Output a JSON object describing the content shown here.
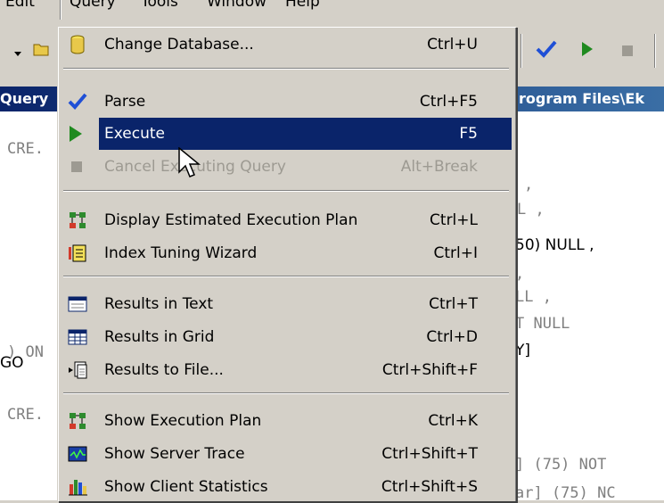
{
  "menubar": {
    "items": [
      "Edit",
      "Query",
      "Tools",
      "Window",
      "Help"
    ]
  },
  "window": {
    "title_left": "Query",
    "title_right": "rogram Files\\Ek"
  },
  "editor": {
    "lines": [
      "CRE.",
      ",",
      "L ,",
      "50) NULL ,",
      ",",
      "LL ,",
      "T NULL",
      ") ON",
      "Y]",
      "GO",
      "CRE.",
      "] (75) NOT",
      "ar] (75) NC"
    ]
  },
  "menu": {
    "items": [
      {
        "label": "Change Database...",
        "shortcut": "Ctrl+U",
        "icon": "cylinder-database-icon",
        "state": "normal"
      },
      {
        "label": "Parse",
        "shortcut": "Ctrl+F5",
        "icon": "checkmark-icon",
        "state": "normal"
      },
      {
        "label": "Execute",
        "shortcut": "F5",
        "icon": "play-icon",
        "state": "selected"
      },
      {
        "label": "Cancel Executing Query",
        "shortcut": "Alt+Break",
        "icon": "stop-icon",
        "state": "disabled"
      },
      {
        "label": "Display Estimated Execution Plan",
        "shortcut": "Ctrl+L",
        "icon": "execution-plan-icon",
        "state": "normal"
      },
      {
        "label": "Index Tuning Wizard",
        "shortcut": "Ctrl+I",
        "icon": "index-wizard-icon",
        "state": "normal"
      },
      {
        "label": "Results in Text",
        "shortcut": "Ctrl+T",
        "icon": "results-text-icon",
        "state": "normal"
      },
      {
        "label": "Results in Grid",
        "shortcut": "Ctrl+D",
        "icon": "results-grid-icon",
        "state": "normal"
      },
      {
        "label": "Results to File...",
        "shortcut": "Ctrl+Shift+F",
        "icon": "results-file-icon",
        "state": "normal"
      },
      {
        "label": "Show Execution Plan",
        "shortcut": "Ctrl+K",
        "icon": "execution-plan-icon",
        "state": "normal"
      },
      {
        "label": "Show Server Trace",
        "shortcut": "Ctrl+Shift+T",
        "icon": "server-trace-icon",
        "state": "normal"
      },
      {
        "label": "Show Client Statistics",
        "shortcut": "Ctrl+Shift+S",
        "icon": "client-statistics-icon",
        "state": "normal"
      }
    ]
  }
}
